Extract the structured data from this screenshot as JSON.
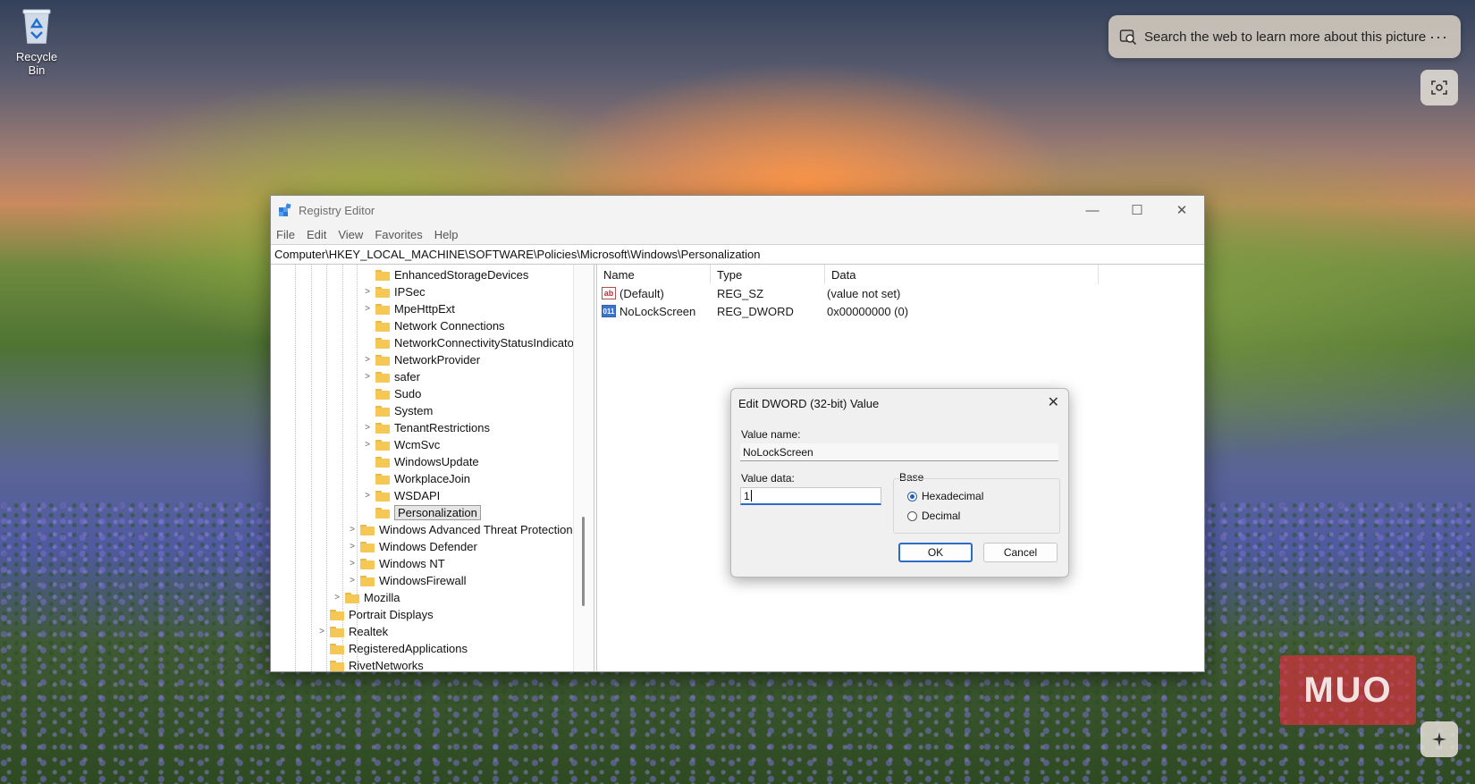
{
  "desktop": {
    "recycle_bin_label": "Recycle Bin",
    "visual_search": "Search the web to learn more about this picture",
    "more_glyph": "···",
    "watermark": "MUO"
  },
  "window": {
    "title": "Registry Editor",
    "minimize": "—",
    "maximize": "☐",
    "close": "✕",
    "menu": [
      "File",
      "Edit",
      "View",
      "Favorites",
      "Help"
    ],
    "address": "Computer\\HKEY_LOCAL_MACHINE\\SOFTWARE\\Policies\\Microsoft\\Windows\\Personalization"
  },
  "tree": [
    {
      "label": "EnhancedStorageDevices",
      "expandable": false,
      "selected": false
    },
    {
      "label": "IPSec",
      "expandable": true,
      "selected": false
    },
    {
      "label": "MpeHttpExt",
      "expandable": true,
      "selected": false
    },
    {
      "label": "Network Connections",
      "expandable": false,
      "selected": false
    },
    {
      "label": "NetworkConnectivityStatusIndicator",
      "expandable": false,
      "selected": false
    },
    {
      "label": "NetworkProvider",
      "expandable": true,
      "selected": false
    },
    {
      "label": "safer",
      "expandable": true,
      "selected": false
    },
    {
      "label": "Sudo",
      "expandable": false,
      "selected": false
    },
    {
      "label": "System",
      "expandable": false,
      "selected": false
    },
    {
      "label": "TenantRestrictions",
      "expandable": true,
      "selected": false
    },
    {
      "label": "WcmSvc",
      "expandable": true,
      "selected": false
    },
    {
      "label": "WindowsUpdate",
      "expandable": false,
      "selected": false
    },
    {
      "label": "WorkplaceJoin",
      "expandable": false,
      "selected": false
    },
    {
      "label": "WSDAPI",
      "expandable": true,
      "selected": false
    },
    {
      "label": "Personalization",
      "expandable": false,
      "selected": true
    },
    {
      "label": "Windows Advanced Threat Protection",
      "expandable": true,
      "selected": false
    },
    {
      "label": "Windows Defender",
      "expandable": true,
      "selected": false
    },
    {
      "label": "Windows NT",
      "expandable": true,
      "selected": false
    },
    {
      "label": "WindowsFirewall",
      "expandable": true,
      "selected": false
    },
    {
      "label": "Mozilla",
      "expandable": true,
      "selected": false
    },
    {
      "label": "Portrait Displays",
      "expandable": false,
      "selected": false
    },
    {
      "label": "Realtek",
      "expandable": true,
      "selected": false
    },
    {
      "label": "RegisteredApplications",
      "expandable": false,
      "selected": false
    },
    {
      "label": "RivetNetworks",
      "expandable": false,
      "selected": false
    }
  ],
  "values_pane": {
    "headers": {
      "name": "Name",
      "type": "Type",
      "data": "Data"
    },
    "rows": [
      {
        "icon": "ab",
        "name": "(Default)",
        "type": "REG_SZ",
        "data": "(value not set)"
      },
      {
        "icon": "011\n110",
        "name": "NoLockScreen",
        "type": "REG_DWORD",
        "data": "0x00000000 (0)"
      }
    ]
  },
  "dialog": {
    "title": "Edit DWORD (32-bit) Value",
    "close": "✕",
    "value_name_label": "Value name:",
    "value_name": "NoLockScreen",
    "value_data_label": "Value data:",
    "value_data": "1",
    "base_label": "Base",
    "hex_label": "Hexadecimal",
    "dec_label": "Decimal",
    "selected_base": "Hexadecimal",
    "ok": "OK",
    "cancel": "Cancel"
  }
}
